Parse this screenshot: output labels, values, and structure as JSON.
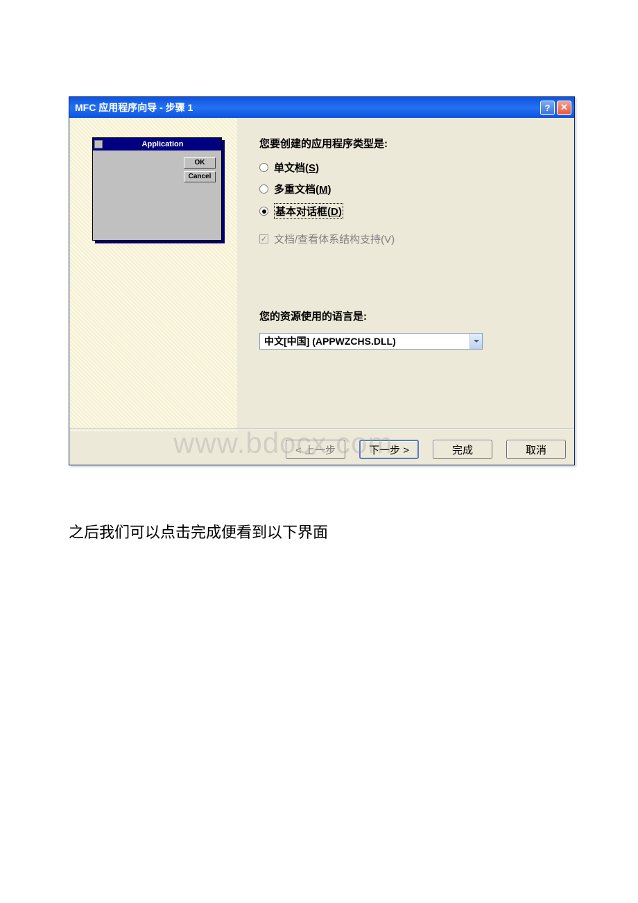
{
  "dialog": {
    "title": "MFC 应用程序向导 - 步骤 1",
    "preview": {
      "title": "Application",
      "ok": "OK",
      "cancel": "Cancel"
    },
    "type_question": "您要创建的应用程序类型是:",
    "radios": [
      {
        "label_prefix": "单文档(",
        "hotkey": "S",
        "label_suffix": ")",
        "selected": false
      },
      {
        "label_prefix": "多重文档(",
        "hotkey": "M",
        "label_suffix": ")",
        "selected": false
      },
      {
        "label_prefix": "基本对话框(",
        "hotkey": "D",
        "label_suffix": ")",
        "selected": true
      }
    ],
    "checkbox": {
      "label": "文档/查看体系结构支持(V)",
      "checked": true,
      "disabled": true
    },
    "lang_question": "您的资源使用的语言是:",
    "lang_value": "中文[中国] (APPWZCHS.DLL)",
    "buttons": {
      "back": "< 上一步",
      "next": "下一步 >",
      "finish": "完成",
      "cancel": "取消"
    }
  },
  "watermark": "www.bdocx.com",
  "body_text": "之后我们可以点击完成便看到以下界面"
}
